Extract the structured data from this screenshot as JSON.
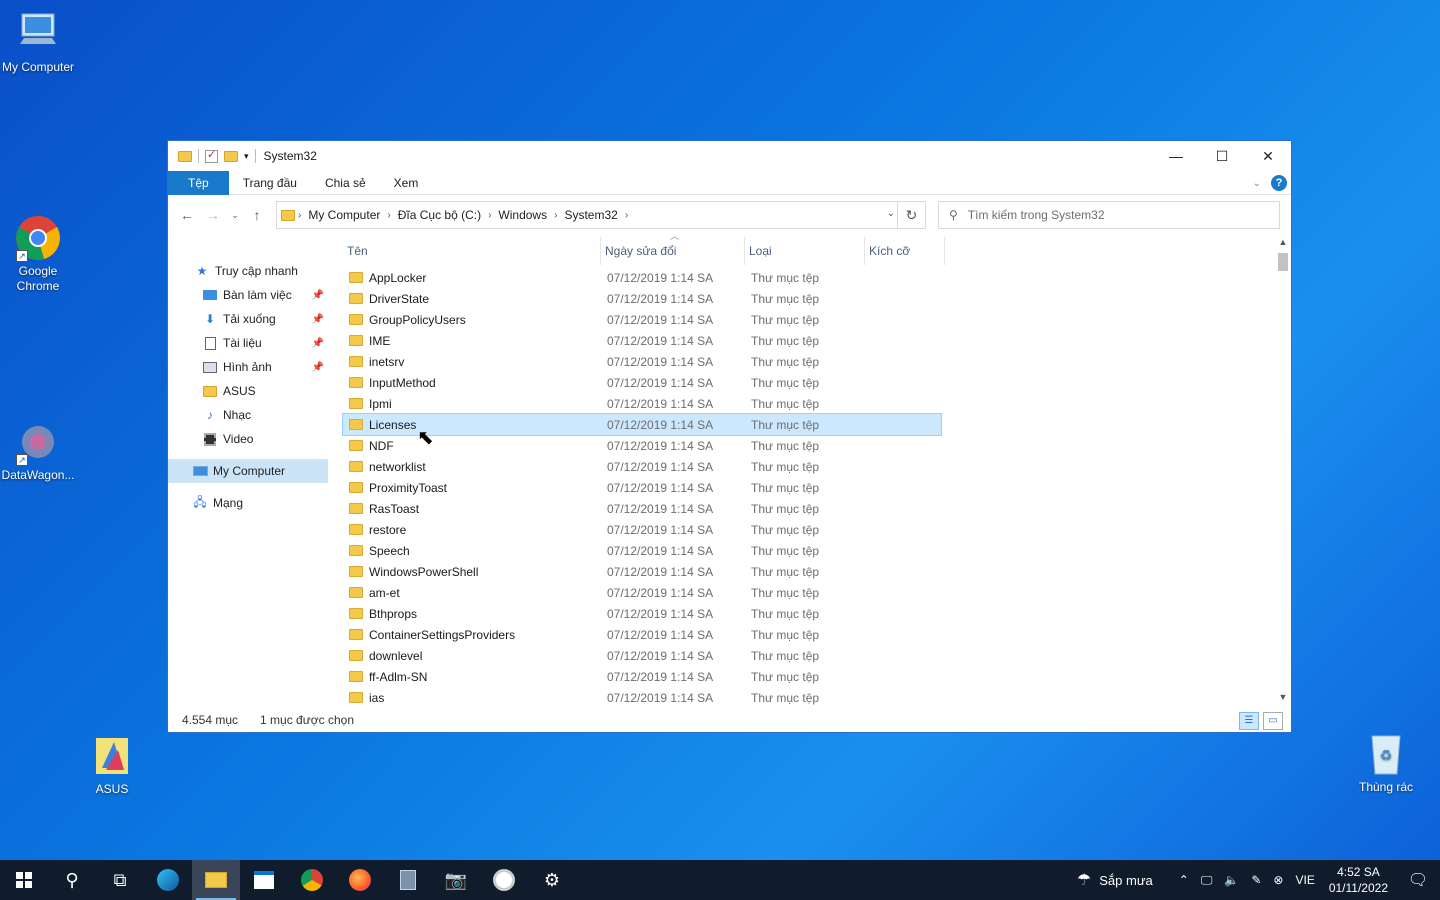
{
  "desktop": {
    "icons": [
      {
        "label": "My Computer"
      },
      {
        "label": "Google Chrome"
      },
      {
        "label": "DataWagon..."
      },
      {
        "label": "ASUS"
      },
      {
        "label": "Thùng rác"
      }
    ]
  },
  "window": {
    "title": "System32",
    "controls": {
      "minimize": "—",
      "maximize": "☐",
      "close": "✕"
    },
    "ribbon_tabs": [
      "Tệp",
      "Trang đầu",
      "Chia sẻ",
      "Xem"
    ],
    "address": {
      "crumbs": [
        "My Computer",
        "Đĩa Cục bộ (C:)",
        "Windows",
        "System32"
      ]
    },
    "search": {
      "placeholder": "Tìm kiếm trong System32"
    },
    "nav_pane": {
      "items": [
        {
          "label": "Truy cập nhanh",
          "icon": "star-icon"
        },
        {
          "label": "Bàn làm việc",
          "icon": "desktop-icon",
          "pinned": true
        },
        {
          "label": "Tải xuống",
          "icon": "download-icon",
          "pinned": true
        },
        {
          "label": "Tài liệu",
          "icon": "document-icon",
          "pinned": true
        },
        {
          "label": "Hình ảnh",
          "icon": "picture-icon",
          "pinned": true
        },
        {
          "label": "ASUS",
          "icon": "folder-icon"
        },
        {
          "label": "Nhạc",
          "icon": "music-icon"
        },
        {
          "label": "Video",
          "icon": "video-icon"
        },
        {
          "label": "My Computer",
          "icon": "computer-icon",
          "selected": true
        },
        {
          "label": "Mạng",
          "icon": "network-icon"
        }
      ]
    },
    "columns": {
      "name": "Tên",
      "date": "Ngày sửa đổi",
      "type": "Loại",
      "size": "Kích cỡ"
    },
    "files": [
      {
        "name": "AppLocker",
        "date": "07/12/2019 1:14 SA",
        "type": "Thư mục tệp"
      },
      {
        "name": "DriverState",
        "date": "07/12/2019 1:14 SA",
        "type": "Thư mục tệp"
      },
      {
        "name": "GroupPolicyUsers",
        "date": "07/12/2019 1:14 SA",
        "type": "Thư mục tệp"
      },
      {
        "name": "IME",
        "date": "07/12/2019 1:14 SA",
        "type": "Thư mục tệp"
      },
      {
        "name": "inetsrv",
        "date": "07/12/2019 1:14 SA",
        "type": "Thư mục tệp"
      },
      {
        "name": "InputMethod",
        "date": "07/12/2019 1:14 SA",
        "type": "Thư mục tệp"
      },
      {
        "name": "Ipmi",
        "date": "07/12/2019 1:14 SA",
        "type": "Thư mục tệp"
      },
      {
        "name": "Licenses",
        "date": "07/12/2019 1:14 SA",
        "type": "Thư mục tệp",
        "selected": true
      },
      {
        "name": "NDF",
        "date": "07/12/2019 1:14 SA",
        "type": "Thư mục tệp"
      },
      {
        "name": "networklist",
        "date": "07/12/2019 1:14 SA",
        "type": "Thư mục tệp"
      },
      {
        "name": "ProximityToast",
        "date": "07/12/2019 1:14 SA",
        "type": "Thư mục tệp"
      },
      {
        "name": "RasToast",
        "date": "07/12/2019 1:14 SA",
        "type": "Thư mục tệp"
      },
      {
        "name": "restore",
        "date": "07/12/2019 1:14 SA",
        "type": "Thư mục tệp"
      },
      {
        "name": "Speech",
        "date": "07/12/2019 1:14 SA",
        "type": "Thư mục tệp"
      },
      {
        "name": "WindowsPowerShell",
        "date": "07/12/2019 1:14 SA",
        "type": "Thư mục tệp"
      },
      {
        "name": "am-et",
        "date": "07/12/2019 1:14 SA",
        "type": "Thư mục tệp"
      },
      {
        "name": "Bthprops",
        "date": "07/12/2019 1:14 SA",
        "type": "Thư mục tệp"
      },
      {
        "name": "ContainerSettingsProviders",
        "date": "07/12/2019 1:14 SA",
        "type": "Thư mục tệp"
      },
      {
        "name": "downlevel",
        "date": "07/12/2019 1:14 SA",
        "type": "Thư mục tệp"
      },
      {
        "name": "ff-Adlm-SN",
        "date": "07/12/2019 1:14 SA",
        "type": "Thư mục tệp"
      },
      {
        "name": "ias",
        "date": "07/12/2019 1:14 SA",
        "type": "Thư mục tệp"
      }
    ],
    "status": {
      "count": "4.554 mục",
      "selection": "1 mục được chọn"
    }
  },
  "taskbar": {
    "weather": "Sắp mưa",
    "language": "VIE",
    "time": "4:52 SA",
    "date": "01/11/2022"
  }
}
